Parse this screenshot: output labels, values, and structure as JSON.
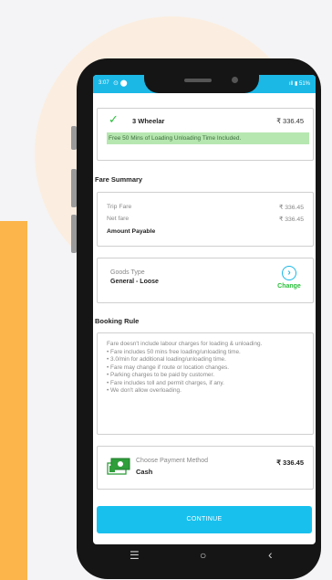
{
  "status_bar": {
    "time": "3:07",
    "left_icons": "⊙ ⬤",
    "battery": "ıll ▮ 51%"
  },
  "vehicle": {
    "name": "3 Wheelar",
    "price": "₹ 336.45",
    "note": "Free 50 Mins of Loading Unloading Time Included."
  },
  "fare_summary": {
    "title": "Fare Summary",
    "rows": [
      {
        "label": "Trip Fare",
        "value": "₹ 336.45"
      },
      {
        "label": "Net fare",
        "value": "₹ 336.45"
      }
    ],
    "payable_label": "Amount Payable"
  },
  "goods": {
    "label": "Goods Type",
    "value": "General - Loose",
    "change_label": "Change"
  },
  "booking_rule": {
    "title": "Booking Rule",
    "lines": [
      "Fare doesn't include labour charges for loading & unloading.",
      "• Fare includes 50 mins free loading/unloading time.",
      "• 3.0/min for additional loading/unloading time.",
      "• Fare may change if route or location changes.",
      "• Parking charges to be paid by customer.",
      "• Fare includes toll and permit charges, if any.",
      "• We don't allow overloading."
    ]
  },
  "payment": {
    "label": "Choose Payment Method",
    "method": "Cash",
    "amount": "₹ 336.45"
  },
  "continue_label": "CONTINUE",
  "nav": {
    "menu": "☰",
    "home": "○",
    "back": "‹"
  },
  "colors": {
    "accent": "#18c0ee",
    "green": "#2bbf3c",
    "banner": "#b6e7b0"
  }
}
